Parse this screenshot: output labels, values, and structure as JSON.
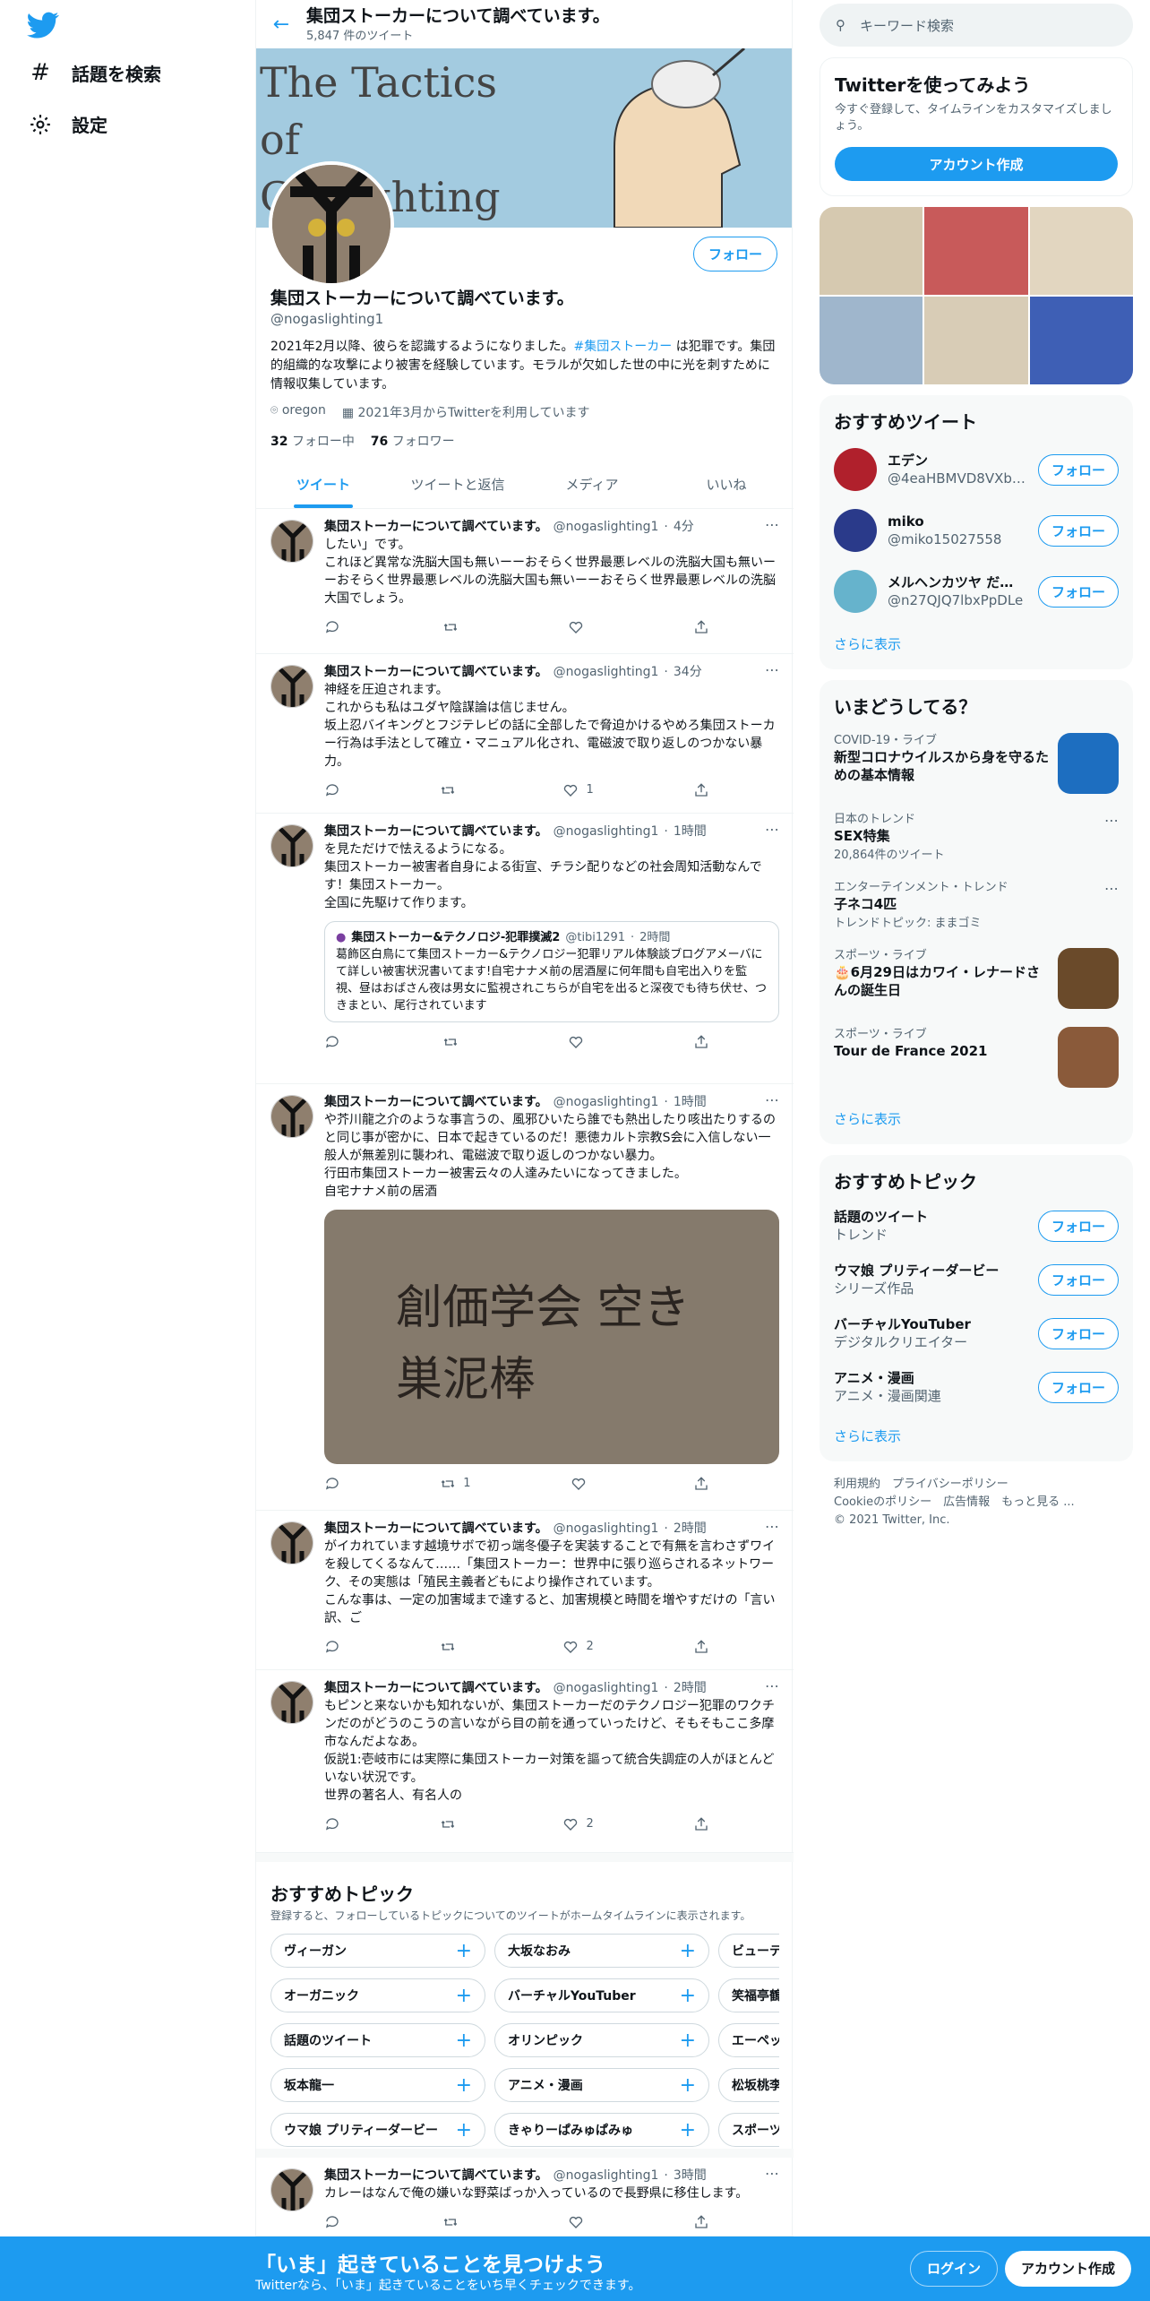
{
  "nav": {
    "explore_label": "話題を検索",
    "settings_label": "設定"
  },
  "header": {
    "title": "集団ストーカーについて調べています。",
    "tweet_count": "5,847 件のツイート"
  },
  "profile": {
    "banner_text": "The Tactics of Gaslighting",
    "name": "集団ストーカーについて調べています。",
    "handle": "@nogaslighting1",
    "follow_label": "フォロー",
    "bio_pre": "2021年2月以降、彼らを認識するようになりました。",
    "bio_tag": "#集団ストーカー",
    "bio_post": " は犯罪です。集団的組織的な攻撃により被害を経験しています。モラルが欠如した世の中に光を刺すために情報収集しています。",
    "location": "oregon",
    "joined": "2021年3月からTwitterを利用しています",
    "following_count": "32",
    "following_label": "フォロー中",
    "followers_count": "76",
    "followers_label": "フォロワー"
  },
  "tabs": [
    "ツイート",
    "ツイートと返信",
    "メディア",
    "いいね"
  ],
  "tweets": [
    {
      "name": "集団ストーカーについて調べています。",
      "handle": "@nogaslighting1",
      "time": "4分",
      "text": "したい」です。\nこれほど異常な洗脳大国も無いーーおそらく世界最悪レベルの洗脳大国も無いーーおそらく世界最悪レベルの洗脳大国も無いーーおそらく世界最悪レベルの洗脳大国でしょう。",
      "retweets": "",
      "likes": ""
    },
    {
      "name": "集団ストーカーについて調べています。",
      "handle": "@nogaslighting1",
      "time": "34分",
      "text": "神経を圧迫されます。\nこれからも私はユダヤ陰謀論は信じません。\n坂上忍バイキングとフジテレビの話に全部したで脅迫かけるやめろ集団ストーカー行為は手法として確立・マニュアル化され、電磁波で取り返しのつかない暴力。",
      "retweets": "",
      "likes": "1"
    },
    {
      "name": "集団ストーカーについて調べています。",
      "handle": "@nogaslighting1",
      "time": "1時間",
      "text": "を見ただけで怯えるようになる。\n集団ストーカー被害者自身による街宣、チラシ配りなどの社会周知活動なんです！集団ストーカー。\n全国に先駆けて作ります。",
      "quote_name": "集団ストーカー&テクノロジ-犯罪撲滅2",
      "quote_handle": "@tibi1291",
      "quote_time": "2時間",
      "quote_text": "葛飾区白鳥にて集団ストーカー&テクノロジー犯罪リアル体験談ブログアメーバにて詳しい被害状況書いてます!自宅ナナメ前の居酒屋に何年間も自宅出入りを監視、昼はおばさん夜は男女に監視されこちらが自宅を出ると深夜でも待ち伏せ、つきまとい、尾行されています",
      "retweets": "",
      "likes": ""
    },
    {
      "name": "集団ストーカーについて調べています。",
      "handle": "@nogaslighting1",
      "time": "1時間",
      "text": "や芥川龍之介のような事言うの、風邪ひいたら誰でも熱出したり咳出たりするのと同じ事が密かに、日本で起きているのだ！悪徳カルト宗教S会に入信しない一般人が無差別に襲われ、電磁波で取り返しのつかない暴力。\n行田市集団ストーカー被害云々の人達みたいになってきました。\n自宅ナナメ前の居酒",
      "photo_text": "創価学会 空き巣泥棒",
      "retweets": "1",
      "likes": ""
    },
    {
      "name": "集団ストーカーについて調べています。",
      "handle": "@nogaslighting1",
      "time": "2時間",
      "text": "がイカれています越境サボで初っ端冬優子を実装することで有無を言わさずワイを殺してくるなんて……「集団ストーカー：世界中に張り巡らされるネットワーク、その実態は「殖民主義者どもにより操作されています。\nこんな事は、一定の加害域まで達すると、加害規模と時間を増やすだけの「言い訳、ご",
      "retweets": "",
      "likes": "2"
    },
    {
      "name": "集団ストーカーについて調べています。",
      "handle": "@nogaslighting1",
      "time": "2時間",
      "text": "もピンと来ないかも知れないが、集団ストーカーだのテクノロジー犯罪のワクチンだのがどうのこうの言いながら目の前を通っていったけど、そもそもここ多摩市なんだよなあ。\n仮説1:壱岐市には実際に集団ストーカー対策を謳って統合失調症の人がほとんどいない状況です。\n世界の著名人、有名人の",
      "retweets": "",
      "likes": "2"
    },
    {
      "name": "集団ストーカーについて調べています。",
      "handle": "@nogaslighting1",
      "time": "3時間",
      "text": "カレーはなんで俺の嫌いな野菜ばっか入っているので長野県に移住します。",
      "retweets": "",
      "likes": ""
    }
  ],
  "topics_block": {
    "title": "おすすめトピック",
    "desc": "登録すると、フォローしているトピックについてのツイートがホームタイムラインに表示されます。",
    "rows": [
      [
        "ヴィーガン",
        "大坂なおみ",
        "ビューティー"
      ],
      [
        "オーガニック",
        "バーチャルYouTuber",
        "笑福亭鶴瓶"
      ],
      [
        "話題のツイート",
        "オリンピック",
        "エーペックスレ"
      ],
      [
        "坂本龍一",
        "アニメ・漫画",
        "松坂桃李"
      ],
      [
        "ウマ娘 プリティーダービー",
        "きゃりーぱみゅぱみゅ",
        "スポーツ"
      ]
    ]
  },
  "right": {
    "search_placeholder": "キーワード検索",
    "signup_title": "Twitterを使ってみよう",
    "signup_desc": "今すぐ登録して、タイムラインをカスタマイズしましょう。",
    "signup_button": "アカウント作成",
    "recommended_title": "おすすめツイート",
    "recommended": [
      {
        "name": "エデン",
        "handle": "@4eaHBMVD8VXb…",
        "color": "#b0202c"
      },
      {
        "name": "miko",
        "handle": "@miko15027558",
        "color": "#2a3a8a"
      },
      {
        "name": "メルヘンカツヤ だ…",
        "handle": "@n27QJQ7lbxPpDLe",
        "color": "#66b3cc"
      }
    ],
    "follow_label": "フォロー",
    "show_more": "さらに表示",
    "trends_title": "いまどうしてる？",
    "trends": [
      {
        "ctx": "COVID-19・ライブ",
        "title": "新型コロナウイルスから身を守るための基本情報",
        "count": "",
        "has_img": true,
        "img_color": "#1d6ec0"
      },
      {
        "ctx": "日本のトレンド",
        "title": "SEX特集",
        "count": "20,864件のツイート",
        "has_img": false
      },
      {
        "ctx": "エンターテインメント・トレンド",
        "title": "子ネコ4匹",
        "count": "トレンドトピック: ままゴミ",
        "has_img": false
      },
      {
        "ctx": "スポーツ・ライブ",
        "title": "🎂6月29日はカワイ・レナードさんの誕生日",
        "count": "",
        "has_img": true,
        "img_color": "#6a4a2a"
      },
      {
        "ctx": "スポーツ・ライブ",
        "title": "Tour de France 2021",
        "count": "",
        "has_img": true,
        "img_color": "#8a5a3a"
      }
    ],
    "topics_title": "おすすめトピック",
    "topics": [
      {
        "name": "話題のツイート",
        "sub": "トレンド"
      },
      {
        "name": "ウマ娘 プリティーダービー",
        "sub": "シリーズ作品"
      },
      {
        "name": "バーチャルYouTuber",
        "sub": "デジタルクリエイター"
      },
      {
        "name": "アニメ・漫画",
        "sub": "アニメ・漫画関連"
      }
    ],
    "footer_line1": "利用規約　プライバシーポリシー",
    "footer_line2": "Cookieのポリシー　広告情報　もっと見る ...",
    "footer_line3": "© 2021 Twitter, Inc."
  },
  "bottom": {
    "title": "「いま」起きていることを見つけよう",
    "subtitle": "Twitterなら、「いま」起きていることをいち早くチェックできます。",
    "login": "ログイン",
    "signup": "アカウント作成"
  },
  "colors": {
    "accent": "#1d9bf0",
    "text": "#0f1419",
    "muted": "#536471"
  }
}
